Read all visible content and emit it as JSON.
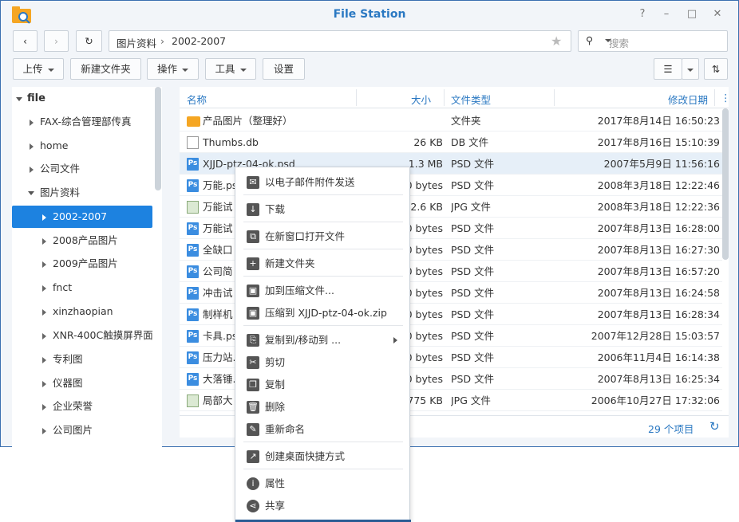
{
  "window": {
    "title": "File Station"
  },
  "nav": {
    "path_root": "图片资料",
    "path_current": "2002-2007",
    "search_placeholder": "搜索"
  },
  "toolbar": {
    "upload": "上传",
    "new_folder": "新建文件夹",
    "action": "操作",
    "tools": "工具",
    "settings": "设置"
  },
  "sidebar": {
    "root": "file",
    "items": [
      {
        "label": "FAX-综合管理部传真",
        "level": 1,
        "expanded": false
      },
      {
        "label": "home",
        "level": 1,
        "expanded": false
      },
      {
        "label": "公司文件",
        "level": 1,
        "expanded": false
      },
      {
        "label": "图片资料",
        "level": 1,
        "expanded": true
      },
      {
        "label": "2002-2007",
        "level": 2,
        "selected": true
      },
      {
        "label": "2008产品图片",
        "level": 2
      },
      {
        "label": "2009产品图片",
        "level": 2
      },
      {
        "label": "fnct",
        "level": 2
      },
      {
        "label": "xinzhaopian",
        "level": 2
      },
      {
        "label": "XNR-400C触摸屏界面",
        "level": 2
      },
      {
        "label": "专利图",
        "level": 2
      },
      {
        "label": "仪器图",
        "level": 2
      },
      {
        "label": "企业荣誉",
        "level": 2
      },
      {
        "label": "公司图片",
        "level": 2
      }
    ]
  },
  "table": {
    "columns": {
      "name": "名称",
      "size": "大小",
      "type": "文件类型",
      "modified": "修改日期"
    },
    "rows": [
      {
        "icon": "folder",
        "name": "产品图片（整理好）",
        "size": "",
        "type": "文件夹",
        "modified": "2017年8月14日 16:50:23"
      },
      {
        "icon": "doc",
        "name": "Thumbs.db",
        "size": "26 KB",
        "type": "DB 文件",
        "modified": "2017年8月16日 15:10:39"
      },
      {
        "icon": "psd",
        "name": "XJJD-ptz-04-ok.psd",
        "size": "1.3 MB",
        "type": "PSD 文件",
        "modified": "2007年5月9日 11:56:16"
      },
      {
        "icon": "psd",
        "name": "万能.ps",
        "size": "0 bytes",
        "type": "PSD 文件",
        "modified": "2008年3月18日 12:22:46"
      },
      {
        "icon": "jpg",
        "name": "万能试",
        "size": "2.6 KB",
        "type": "JPG 文件",
        "modified": "2008年3月18日 12:22:36"
      },
      {
        "icon": "psd",
        "name": "万能试",
        "size": "0 bytes",
        "type": "PSD 文件",
        "modified": "2007年8月13日 16:28:00"
      },
      {
        "icon": "psd",
        "name": "全缺口",
        "size": "0 bytes",
        "type": "PSD 文件",
        "modified": "2007年8月13日 16:27:30"
      },
      {
        "icon": "psd",
        "name": "公司简",
        "size": "0 bytes",
        "type": "PSD 文件",
        "modified": "2007年8月13日 16:57:20"
      },
      {
        "icon": "psd",
        "name": "冲击试",
        "size": "0 bytes",
        "type": "PSD 文件",
        "modified": "2007年8月13日 16:24:58"
      },
      {
        "icon": "psd",
        "name": "制样机",
        "size": "0 bytes",
        "type": "PSD 文件",
        "modified": "2007年8月13日 16:28:34"
      },
      {
        "icon": "psd",
        "name": "卡具.ps",
        "size": "0 bytes",
        "type": "PSD 文件",
        "modified": "2007年12月28日 15:03:57"
      },
      {
        "icon": "psd",
        "name": "压力站.",
        "size": "0 bytes",
        "type": "PSD 文件",
        "modified": "2006年11月4日 16:14:38"
      },
      {
        "icon": "psd",
        "name": "大落锤.",
        "size": "0 bytes",
        "type": "PSD 文件",
        "modified": "2007年8月13日 16:25:34"
      },
      {
        "icon": "jpg",
        "name": "局部大",
        "size": "775 KB",
        "type": "JPG 文件",
        "modified": "2006年10月27日 17:32:06"
      }
    ]
  },
  "footer": {
    "count": "29 个项目"
  },
  "context_menu": {
    "items": [
      {
        "label": "以电子邮件附件发送",
        "icon": "mail-icon"
      },
      {
        "label": "下载",
        "icon": "download-icon"
      },
      {
        "label": "在新窗口打开文件",
        "icon": "open-window-icon"
      },
      {
        "label": "新建文件夹",
        "icon": "new-folder-icon"
      },
      {
        "label": "加到压缩文件...",
        "icon": "compress-icon"
      },
      {
        "label": "压缩到 XJJD-ptz-04-ok.zip",
        "icon": "zip-icon"
      },
      {
        "label": "复制到/移动到 ...",
        "icon": "copy-move-icon",
        "submenu": true
      },
      {
        "label": "剪切",
        "icon": "cut-icon"
      },
      {
        "label": "复制",
        "icon": "copy-icon"
      },
      {
        "label": "删除",
        "icon": "delete-icon"
      },
      {
        "label": "重新命名",
        "icon": "rename-icon"
      },
      {
        "label": "创建桌面快捷方式",
        "icon": "shortcut-icon"
      },
      {
        "label": "属性",
        "icon": "info-icon"
      },
      {
        "label": "共享",
        "icon": "share-icon"
      }
    ]
  },
  "colors": {
    "accent": "#1d82e0",
    "title": "#2a78c2",
    "border": "#3a6fb0"
  }
}
